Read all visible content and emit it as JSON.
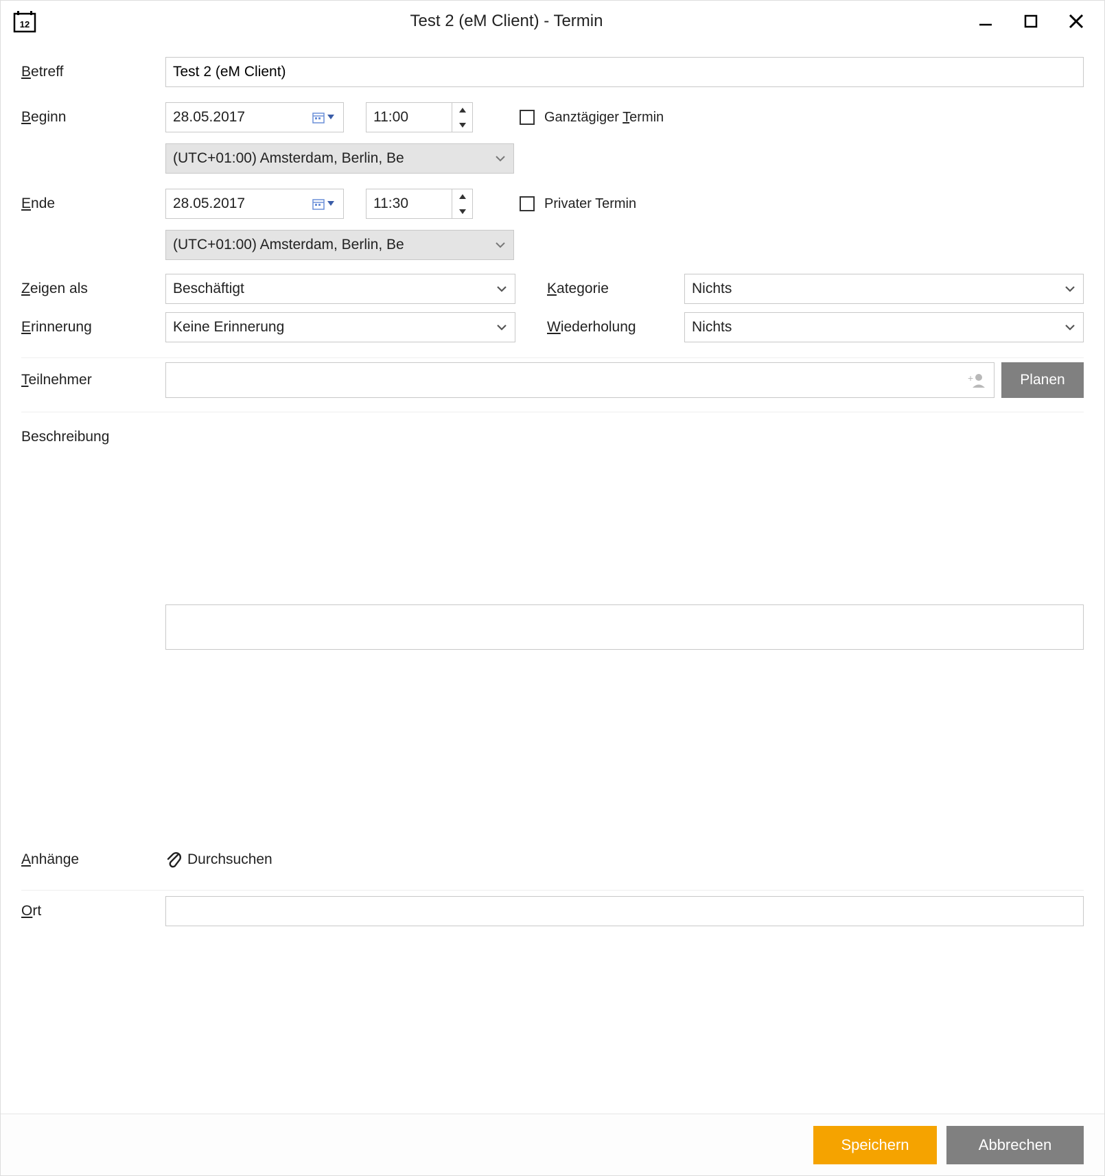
{
  "window": {
    "title": "Test 2 (eM Client) - Termin",
    "app_icon_day": "12"
  },
  "labels": {
    "subject": "Betreff",
    "begin": "Beginn",
    "end": "Ende",
    "show_as": "Zeigen als",
    "reminder": "Erinnerung",
    "category": "Kategorie",
    "recurrence": "Wiederholung",
    "participants": "Teilnehmer",
    "description": "Beschreibung",
    "attachments": "Anhänge",
    "location": "Ort"
  },
  "fields": {
    "subject_value": "Test 2 (eM Client)",
    "begin_date": "28.05.2017",
    "begin_time": "11:00",
    "begin_tz": "(UTC+01:00) Amsterdam, Berlin, Be",
    "end_date": "28.05.2017",
    "end_time": "11:30",
    "end_tz": "(UTC+01:00) Amsterdam, Berlin, Be",
    "show_as_value": "Beschäftigt",
    "reminder_value": "Keine Erinnerung",
    "category_value": "Nichts",
    "recurrence_value": "Nichts",
    "participants_value": "",
    "description_value": "",
    "location_value": ""
  },
  "checkboxes": {
    "all_day_label": "Ganztägiger Termin",
    "all_day_checked": false,
    "private_label": "Privater Termin",
    "private_checked": false
  },
  "buttons": {
    "plan": "Planen",
    "browse_attach": "Durchsuchen",
    "save": "Speichern",
    "cancel": "Abbrechen"
  },
  "colors": {
    "accent": "#f5a300",
    "button_gray": "#808080"
  }
}
